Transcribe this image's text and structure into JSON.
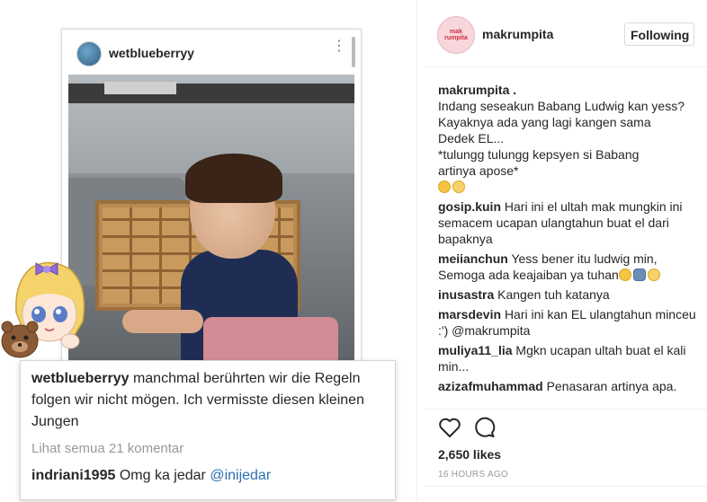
{
  "post_image": {
    "card_username": "wetblueberryy",
    "overlay_comment_user": "wetblueberryy",
    "overlay_comment_text": "manchmal berührten wir die Regeln folgen wir nicht mögen. Ich vermisste diesen kleinen Jungen",
    "overlay_view_all": "Lihat semua 21 komentar",
    "overlay_reply_user": "indriani1995",
    "overlay_reply_text": "Omg ka jedar",
    "overlay_reply_mention": "@inijedar"
  },
  "header": {
    "username": "makrumpita",
    "avatar_text": "mak rumpita",
    "follow_label": "Following"
  },
  "caption": {
    "user": "makrumpita .",
    "lines": [
      "Indang seseakun Babang Ludwig kan yess?",
      "Kayaknya ada yang lagi kangen sama",
      "Dedek EL...",
      "*tulungg tulungg kepsyen si Babang",
      "artinya apose*"
    ]
  },
  "comments": [
    {
      "user": "gosip.kuin",
      "text": "Hari ini el ultah mak mungkin ini semacem ucapan ulangtahun buat el dari bapaknya"
    },
    {
      "user": "meiianchun",
      "text": "Yess bener itu ludwig min, Semoga ada keajaiban ya tuhan"
    },
    {
      "user": "inusastra",
      "text": "Kangen tuh katanya"
    },
    {
      "user": "marsdevin",
      "text": "Hari ini kan EL ulangtahun minceu :')",
      "mention": "@makrumpita"
    },
    {
      "user": "muliya11_lia",
      "text": "Mgkn ucapan ultah buat el kali min..."
    },
    {
      "user": "azizafmuhammad",
      "text": "Penasaran artinya apa."
    }
  ],
  "actions": {
    "likes": "2,650 likes",
    "time": "16 HOURS AGO"
  },
  "icons": [
    "heart-icon",
    "comment-icon",
    "more-dots-icon"
  ]
}
